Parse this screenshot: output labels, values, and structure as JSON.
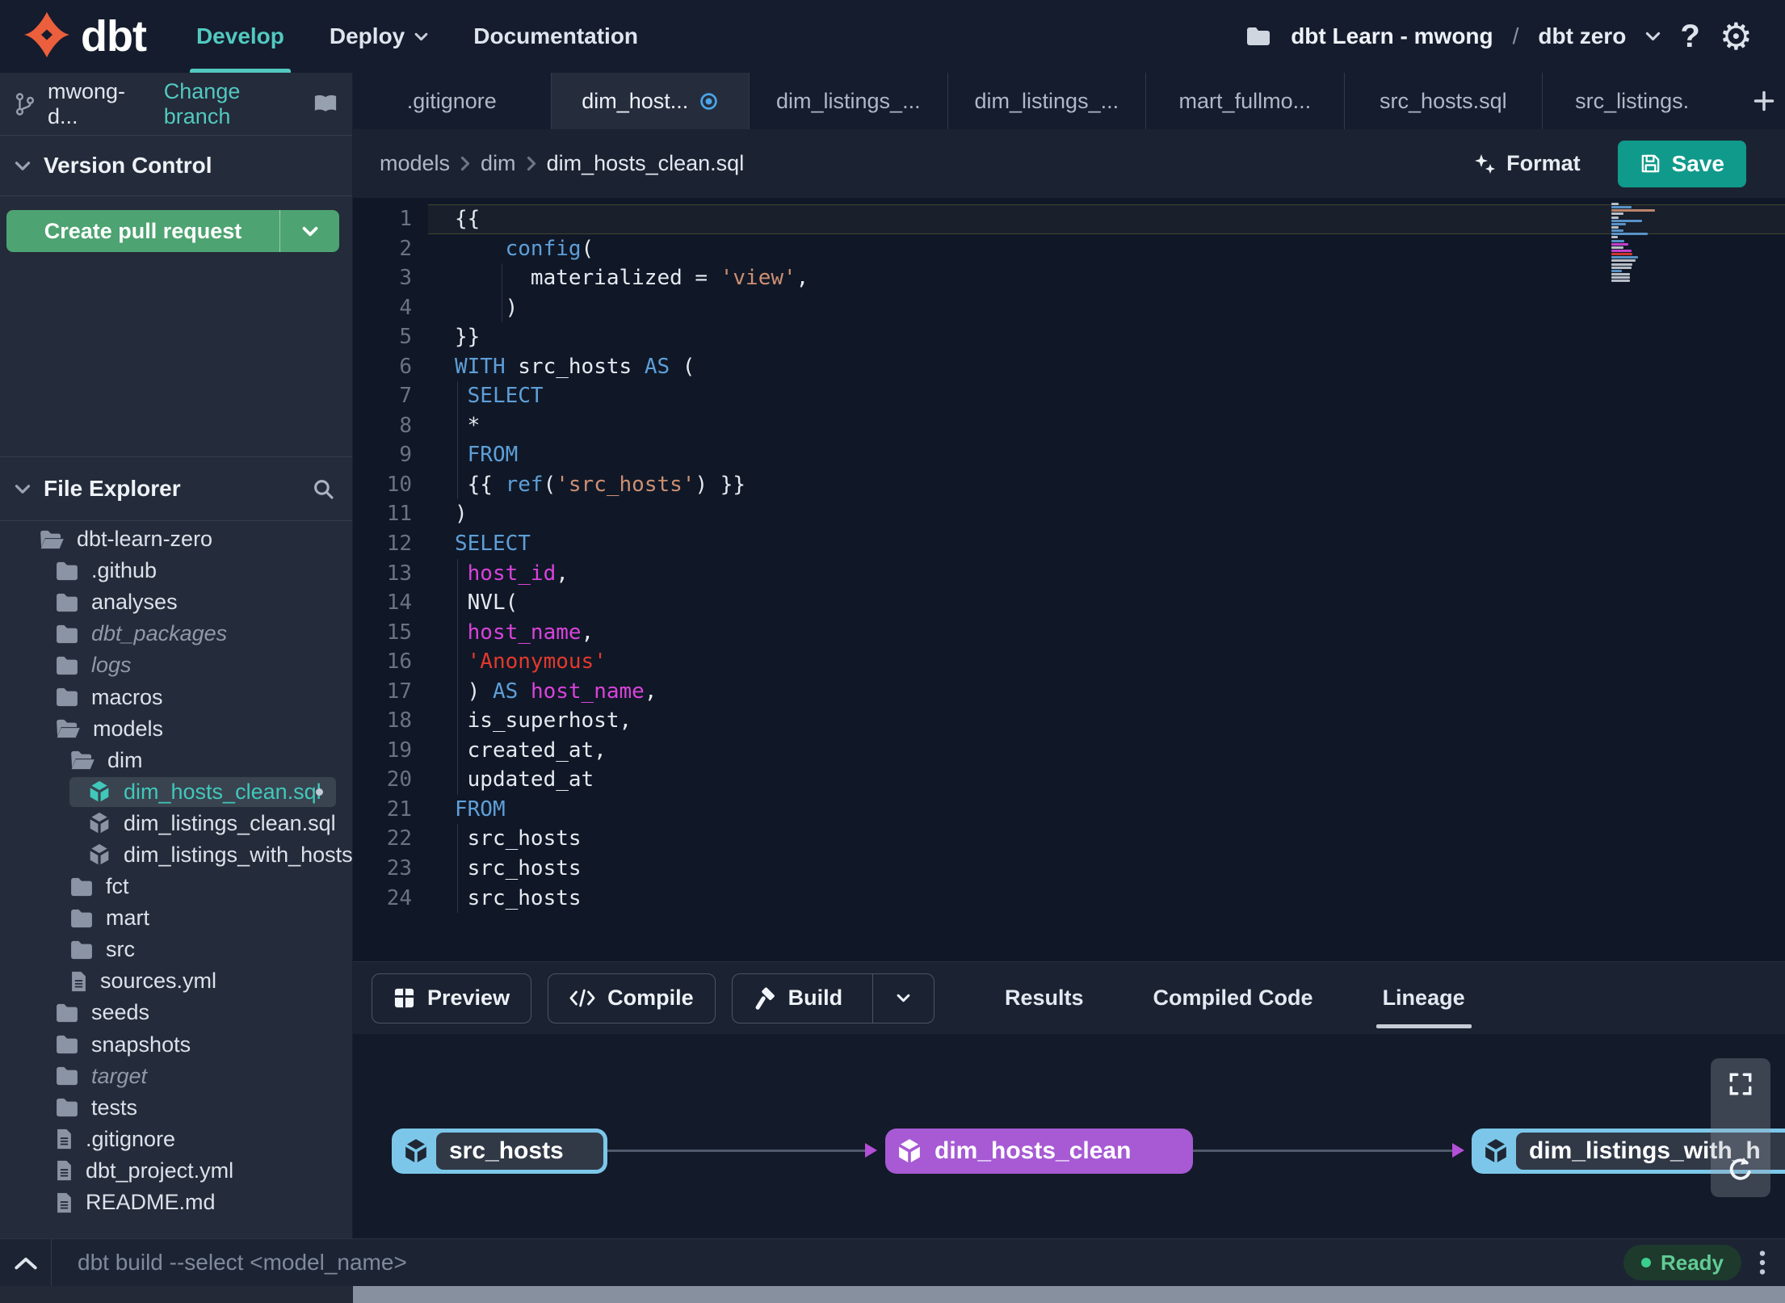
{
  "topnav": {
    "brand": "dbt",
    "items": [
      {
        "label": "Develop",
        "active": true
      },
      {
        "label": "Deploy",
        "has_chevron": true
      },
      {
        "label": "Documentation"
      }
    ],
    "project": {
      "account": "dbt Learn - mwong",
      "separator": "/",
      "name": "dbt zero"
    }
  },
  "sidebar": {
    "branch": {
      "name": "mwong-d...",
      "change_link": "Change branch"
    },
    "version_control": {
      "title": "Version Control",
      "create_pr_label": "Create pull request"
    },
    "file_explorer": {
      "title": "File Explorer",
      "tree": [
        {
          "label": "dbt-learn-zero",
          "icon": "folder-open",
          "level": 0
        },
        {
          "label": ".github",
          "icon": "folder",
          "level": 1
        },
        {
          "label": "analyses",
          "icon": "folder",
          "level": 1
        },
        {
          "label": "dbt_packages",
          "icon": "folder",
          "level": 1,
          "muted": true
        },
        {
          "label": "logs",
          "icon": "folder",
          "level": 1,
          "muted": true
        },
        {
          "label": "macros",
          "icon": "folder",
          "level": 1
        },
        {
          "label": "models",
          "icon": "folder-open",
          "level": 1
        },
        {
          "label": "dim",
          "icon": "folder-open",
          "level": 2
        },
        {
          "label": "dim_hosts_clean.sql",
          "icon": "model",
          "level": 3,
          "selected": true,
          "modified": true
        },
        {
          "label": "dim_listings_clean.sql",
          "icon": "model",
          "level": 3
        },
        {
          "label": "dim_listings_with_hosts...",
          "icon": "model",
          "level": 3
        },
        {
          "label": "fct",
          "icon": "folder",
          "level": 2
        },
        {
          "label": "mart",
          "icon": "folder",
          "level": 2
        },
        {
          "label": "src",
          "icon": "folder",
          "level": 2
        },
        {
          "label": "sources.yml",
          "icon": "file",
          "level": 2
        },
        {
          "label": "seeds",
          "icon": "folder",
          "level": 1
        },
        {
          "label": "snapshots",
          "icon": "folder",
          "level": 1
        },
        {
          "label": "target",
          "icon": "folder",
          "level": 1,
          "muted": true
        },
        {
          "label": "tests",
          "icon": "folder",
          "level": 1
        },
        {
          "label": ".gitignore",
          "icon": "file",
          "level": 1
        },
        {
          "label": "dbt_project.yml",
          "icon": "file",
          "level": 1
        },
        {
          "label": "README.md",
          "icon": "file",
          "level": 1
        }
      ]
    }
  },
  "tabs": {
    "items": [
      {
        "label": ".gitignore"
      },
      {
        "label": "dim_host...",
        "active": true,
        "modified": true
      },
      {
        "label": "dim_listings_..."
      },
      {
        "label": "dim_listings_..."
      },
      {
        "label": "mart_fullmo..."
      },
      {
        "label": "src_hosts.sql"
      },
      {
        "label": "src_listings."
      }
    ],
    "add_label": "+"
  },
  "breadcrumb": {
    "segments": [
      "models",
      "dim",
      "dim_hosts_clean.sql"
    ]
  },
  "actions": {
    "format_label": "Format",
    "save_label": "Save"
  },
  "editor": {
    "lines": [
      {
        "n": 1,
        "hl": true,
        "tokens": [
          {
            "t": "{{",
            "c": "p"
          }
        ]
      },
      {
        "n": 2,
        "tokens": [
          {
            "t": "    ",
            "c": "p"
          },
          {
            "t": "config",
            "c": "k"
          },
          {
            "t": "(",
            "c": "p"
          }
        ]
      },
      {
        "n": 3,
        "g": [
          3.8
        ],
        "tokens": [
          {
            "t": "      materialized = ",
            "c": "p"
          },
          {
            "t": "'view'",
            "c": "s"
          },
          {
            "t": ",",
            "c": "p"
          }
        ]
      },
      {
        "n": 4,
        "g": [
          3.8
        ],
        "tokens": [
          {
            "t": "    )",
            "c": "p"
          }
        ]
      },
      {
        "n": 5,
        "tokens": [
          {
            "t": "}}",
            "c": "p"
          }
        ]
      },
      {
        "n": 6,
        "tokens": [
          {
            "t": "WITH",
            "c": "k"
          },
          {
            "t": " src_hosts ",
            "c": "p"
          },
          {
            "t": "AS",
            "c": "k"
          },
          {
            "t": " (",
            "c": "p"
          }
        ]
      },
      {
        "n": 7,
        "g": [
          0.1
        ],
        "tokens": [
          {
            "t": " ",
            "c": "p"
          },
          {
            "t": "SELECT",
            "c": "k"
          }
        ]
      },
      {
        "n": 8,
        "g": [
          0.1
        ],
        "tokens": [
          {
            "t": " *",
            "c": "p"
          }
        ]
      },
      {
        "n": 9,
        "g": [
          0.1
        ],
        "tokens": [
          {
            "t": " ",
            "c": "p"
          },
          {
            "t": "FROM",
            "c": "k"
          }
        ]
      },
      {
        "n": 10,
        "g": [
          0.1
        ],
        "tokens": [
          {
            "t": " {{ ",
            "c": "p"
          },
          {
            "t": "ref",
            "c": "k"
          },
          {
            "t": "(",
            "c": "p"
          },
          {
            "t": "'src_hosts'",
            "c": "s"
          },
          {
            "t": ") }}",
            "c": "p"
          }
        ]
      },
      {
        "n": 11,
        "tokens": [
          {
            "t": ")",
            "c": "p"
          }
        ]
      },
      {
        "n": 12,
        "tokens": [
          {
            "t": "SELECT",
            "c": "k"
          }
        ]
      },
      {
        "n": 13,
        "g": [
          0.1
        ],
        "tokens": [
          {
            "t": " ",
            "c": "p"
          },
          {
            "t": "host_id",
            "c": "i"
          },
          {
            "t": ",",
            "c": "p"
          }
        ]
      },
      {
        "n": 14,
        "g": [
          0.1
        ],
        "tokens": [
          {
            "t": " NVL(",
            "c": "p"
          }
        ]
      },
      {
        "n": 15,
        "g": [
          0.1
        ],
        "tokens": [
          {
            "t": " ",
            "c": "p"
          },
          {
            "t": "host_name",
            "c": "i"
          },
          {
            "t": ",",
            "c": "p"
          }
        ]
      },
      {
        "n": 16,
        "g": [
          0.1
        ],
        "tokens": [
          {
            "t": " ",
            "c": "p"
          },
          {
            "t": "'Anonymous'",
            "c": "r"
          }
        ]
      },
      {
        "n": 17,
        "g": [
          0.1
        ],
        "tokens": [
          {
            "t": " ) ",
            "c": "p"
          },
          {
            "t": "AS",
            "c": "k"
          },
          {
            "t": " ",
            "c": "p"
          },
          {
            "t": "host_name",
            "c": "i"
          },
          {
            "t": ",",
            "c": "p"
          }
        ]
      },
      {
        "n": 18,
        "g": [
          0.1
        ],
        "tokens": [
          {
            "t": " is_superhost,",
            "c": "p"
          }
        ]
      },
      {
        "n": 19,
        "g": [
          0.1
        ],
        "tokens": [
          {
            "t": " created_at,",
            "c": "p"
          }
        ]
      },
      {
        "n": 20,
        "g": [
          0.1
        ],
        "tokens": [
          {
            "t": " updated_at",
            "c": "p"
          }
        ]
      },
      {
        "n": 21,
        "tokens": [
          {
            "t": "FROM",
            "c": "k"
          }
        ]
      },
      {
        "n": 22,
        "g": [
          0.1
        ],
        "tokens": [
          {
            "t": " src_hosts",
            "c": "p"
          }
        ]
      },
      {
        "n": 23,
        "g": [
          0.1
        ],
        "tokens": [
          {
            "t": " src_hosts",
            "c": "p"
          }
        ]
      },
      {
        "n": 24,
        "g": [
          0.1
        ],
        "tokens": [
          {
            "t": " src_hosts",
            "c": "p"
          }
        ]
      }
    ]
  },
  "panel": {
    "buttons": [
      {
        "label": "Preview",
        "icon": "grid"
      },
      {
        "label": "Compile",
        "icon": "code"
      },
      {
        "label": "Build",
        "icon": "hammer",
        "split": true
      }
    ],
    "tabs": [
      {
        "label": "Results"
      },
      {
        "label": "Compiled Code"
      },
      {
        "label": "Lineage",
        "active": true
      }
    ]
  },
  "lineage": {
    "nodes": [
      {
        "label": "src_hosts",
        "color": "blue"
      },
      {
        "label": "dim_hosts_clean",
        "color": "purple"
      },
      {
        "label": "dim_listings_with_h",
        "color": "blue"
      }
    ]
  },
  "statusbar": {
    "command_placeholder": "dbt build --select <model_name>",
    "status": "Ready"
  },
  "colors": {
    "accent_teal": "#52c9c0",
    "save_teal": "#109a8b",
    "pr_green": "#4da371",
    "logo_orange": "#ec5f3c",
    "node_blue": "#7cc7e9",
    "node_purple": "#a75ad4",
    "arrow_purple": "#b44fd8",
    "ready_green": "#3bcf8e",
    "modified_blue": "#4ba5e8",
    "syntax_keyword": "#5e9fd8",
    "syntax_string": "#cd8f72",
    "syntax_string_red": "#e3392c",
    "syntax_identifier": "#d943db",
    "syntax_plain": "#e6eaf0"
  }
}
